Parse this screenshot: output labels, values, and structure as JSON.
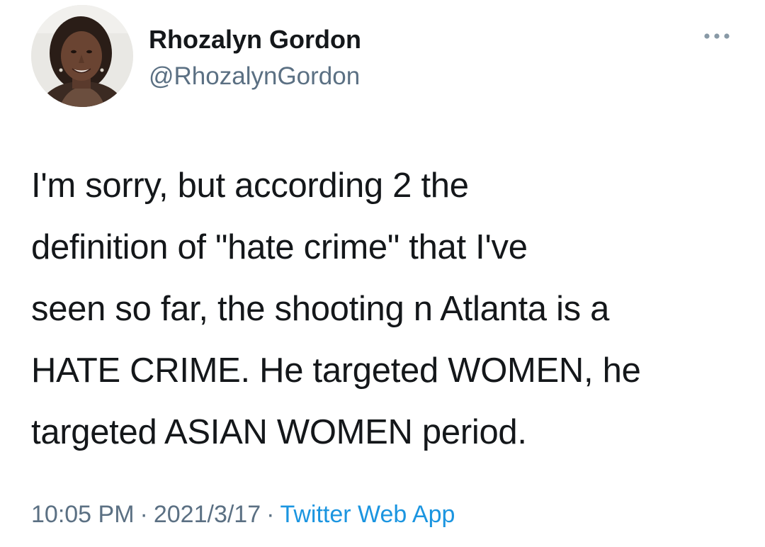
{
  "author": {
    "display_name": "Rhozalyn Gordon",
    "handle": "@RhozalynGordon",
    "avatar_icon": "profile-photo"
  },
  "more_icon": "ellipsis-icon",
  "tweet": {
    "lines": [
      "I'm sorry, but according 2 the",
      "definition of \"hate crime\" that I've",
      "seen so far, the shooting n Atlanta is a",
      "HATE CRIME. He targeted WOMEN, he",
      "targeted ASIAN WOMEN period."
    ]
  },
  "meta": {
    "time": "10:05 PM",
    "separator": "·",
    "date": "2021/3/17",
    "source": "Twitter Web App"
  },
  "colors": {
    "text": "#14171a",
    "secondary": "#5b7083",
    "link": "#1b95e0"
  }
}
